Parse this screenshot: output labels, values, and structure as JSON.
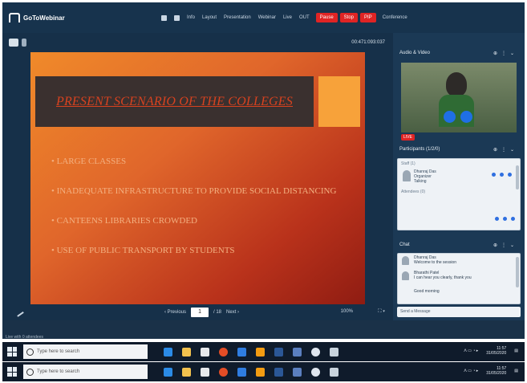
{
  "app": {
    "name": "GoToWebinar"
  },
  "toolbar": {
    "items": [
      "Info",
      "Layout",
      "Presentation",
      "Webinar",
      "Live",
      "OUT"
    ],
    "record_buttons": [
      "Pause",
      "Stop",
      "PIP"
    ],
    "right_label": "Conference"
  },
  "stage": {
    "meeting_id": "00:471:093:037"
  },
  "slide": {
    "title": "PRESENT SCENARIO OF THE COLLEGES",
    "bullets": [
      "• LARGE CLASSES",
      "• INADEQUATE INFRASTRUCTURE TO PROVIDE SOCIAL DISTANCING",
      "• CANTEENS LIBRARIES CROWDED",
      "• USE OF PUBLIC TRANSPORT BY STUDENTS"
    ]
  },
  "pager": {
    "prev_label": "‹ Previous",
    "page": "1",
    "of_label": "/ 18",
    "next_label": "Next ›"
  },
  "footer": {
    "zoom": "100%"
  },
  "panel": {
    "audio_video": {
      "title": "Audio & Video"
    },
    "live_badge": "LIVE",
    "participants": {
      "title": "Participants (1/2/0)",
      "group_label": "Staff (1)",
      "person_name": "Dhanraj Das",
      "person_role": "Organizer",
      "person_status": "Talking",
      "attendees_label": "Attendees (0)"
    },
    "chat": {
      "title": "Chat",
      "messages": [
        {
          "name": "Dhanraj Das",
          "text": "Welcome to the session"
        },
        {
          "name": "Bharathi Patel",
          "text": "I can hear you clearly, thank you"
        },
        {
          "name": "",
          "text": "Good morning"
        }
      ],
      "input_placeholder": "Send a Message"
    }
  },
  "status": {
    "text": "Live with 0 attendees"
  },
  "taskbar": {
    "search_placeholder": "Type here to search",
    "time": "11:57",
    "date": "31/05/2020"
  },
  "colors": {
    "record_red": "#e02424",
    "brand_blue": "#17334d",
    "slide_orange": "#f08a2a"
  }
}
